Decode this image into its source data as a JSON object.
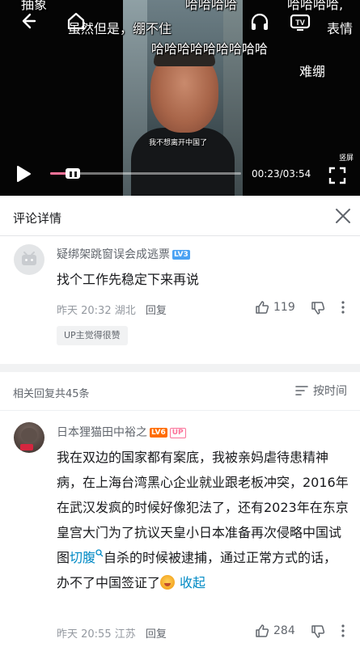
{
  "video": {
    "danmaku": [
      "抽象",
      "哈哈哈哈",
      "哈哈哈哈,",
      "虽然但是，绷不住",
      "表情",
      "哈哈哈哈哈哈哈哈哈",
      "难绷"
    ],
    "subtitle": "我不想离开中国了",
    "fullscreen_label": "竖屏",
    "current_time": "00:23",
    "duration": "03:54",
    "time_display": "00:23/03:54",
    "progress_fraction": 0.098,
    "accent_color": "#fb7299",
    "icons": [
      "back-arrow-icon",
      "home-icon",
      "headphones-icon",
      "tv-cast-icon",
      "play-icon",
      "fullscreen-icon"
    ]
  },
  "panel": {
    "title": "评论详情",
    "close_icon": "close-icon"
  },
  "root_comment": {
    "username": "疑绑架跳窗误会成逃票",
    "level": "LV3",
    "content": "找个工作先稳定下来再说",
    "time": "昨天 20:32",
    "location": "湖北",
    "reply_label": "回复",
    "likes": "119",
    "badge": "UP主觉得很赞"
  },
  "replies_header": {
    "count_label": "相关回复共45条",
    "sort_label": "按时间"
  },
  "reply_comment": {
    "username": "日本狸猫田中裕之",
    "level": "LV6",
    "up_tag": "UP",
    "content_part1": "我在双边的国家都有案底，我被亲妈虐待患精神病，在上海台湾黑心企业就业跟老板冲突，2016年在武汉发疯的时候好像犯法了，还有2023年在东京皇宫大门为了抗议天皇小日本准备再次侵略中国试图",
    "keyword": "切腹",
    "content_part2": "自杀的时候被逮捕，通过正常方式的话，办不了中国签证了",
    "collapse_label": "收起",
    "time": "昨天 20:55",
    "location": "江苏",
    "reply_label": "回复",
    "likes": "284"
  }
}
